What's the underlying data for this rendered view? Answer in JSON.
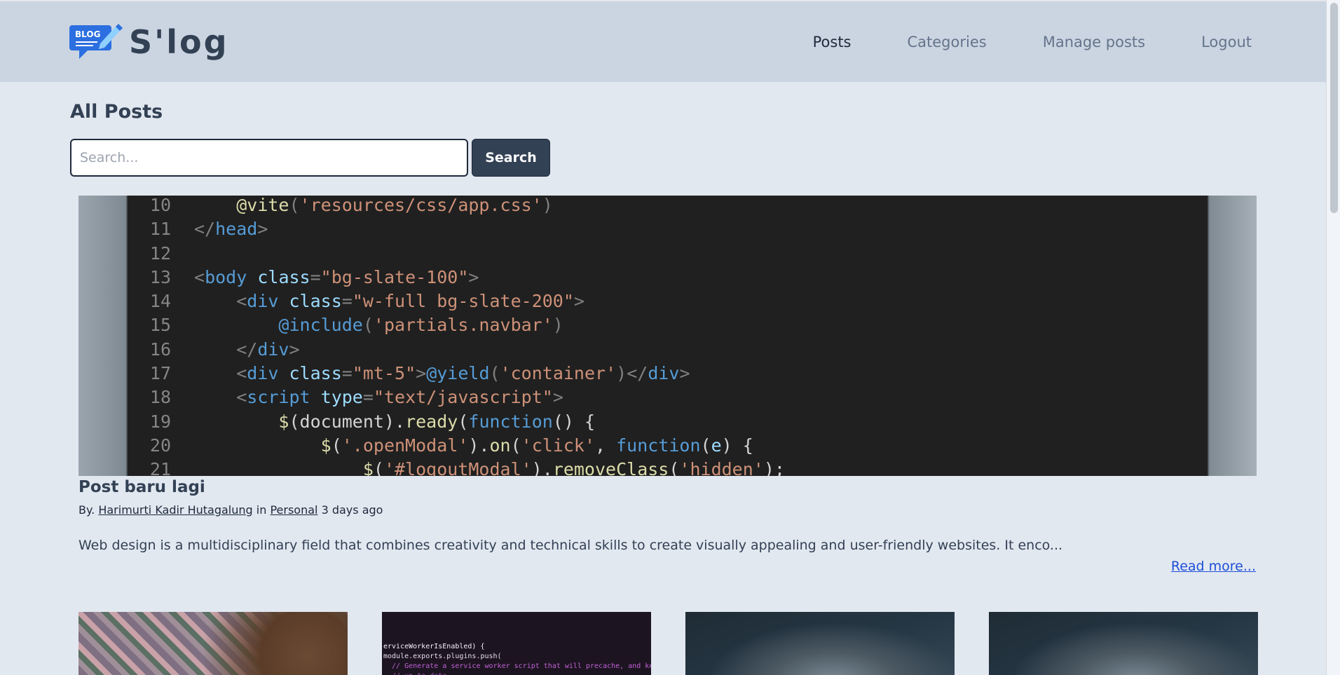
{
  "navbar": {
    "logo_text": "BLOG",
    "brand": "S'log",
    "links": [
      "Posts",
      "Categories",
      "Manage posts",
      "Logout"
    ]
  },
  "page": {
    "title": "All Posts"
  },
  "search": {
    "placeholder": "Search...",
    "button": "Search"
  },
  "featured": {
    "code_lines": [
      {
        "n": "10",
        "tokens": [
          [
            "txt",
            "    "
          ],
          [
            "fn",
            "@vite"
          ],
          [
            "punc",
            "("
          ],
          [
            "str",
            "'resources/css/app.css'"
          ],
          [
            "punc",
            ")"
          ]
        ]
      },
      {
        "n": "11",
        "tokens": [
          [
            "punc",
            "</"
          ],
          [
            "tag",
            "head"
          ],
          [
            "punc",
            ">"
          ]
        ]
      },
      {
        "n": "12",
        "tokens": []
      },
      {
        "n": "13",
        "tokens": [
          [
            "punc",
            "<"
          ],
          [
            "tag",
            "body"
          ],
          [
            "txt",
            " "
          ],
          [
            "attr",
            "class"
          ],
          [
            "punc",
            "="
          ],
          [
            "str",
            "\"bg-slate-100\""
          ],
          [
            "punc",
            ">"
          ]
        ]
      },
      {
        "n": "14",
        "tokens": [
          [
            "txt",
            "    "
          ],
          [
            "punc",
            "<"
          ],
          [
            "tag",
            "div"
          ],
          [
            "txt",
            " "
          ],
          [
            "attr",
            "class"
          ],
          [
            "punc",
            "="
          ],
          [
            "str",
            "\"w-full bg-slate-200\""
          ],
          [
            "punc",
            ">"
          ]
        ]
      },
      {
        "n": "15",
        "tokens": [
          [
            "txt",
            "        "
          ],
          [
            "dir",
            "@include"
          ],
          [
            "punc",
            "("
          ],
          [
            "str",
            "'partials.navbar'"
          ],
          [
            "punc",
            ")"
          ]
        ]
      },
      {
        "n": "16",
        "tokens": [
          [
            "txt",
            "    "
          ],
          [
            "punc",
            "</"
          ],
          [
            "tag",
            "div"
          ],
          [
            "punc",
            ">"
          ]
        ]
      },
      {
        "n": "17",
        "tokens": [
          [
            "txt",
            "    "
          ],
          [
            "punc",
            "<"
          ],
          [
            "tag",
            "div"
          ],
          [
            "txt",
            " "
          ],
          [
            "attr",
            "class"
          ],
          [
            "punc",
            "="
          ],
          [
            "str",
            "\"mt-5\""
          ],
          [
            "punc",
            ">"
          ],
          [
            "dir",
            "@yield"
          ],
          [
            "punc",
            "("
          ],
          [
            "str",
            "'container'"
          ],
          [
            "punc",
            ")"
          ],
          [
            "punc",
            "</"
          ],
          [
            "tag",
            "div"
          ],
          [
            "punc",
            ">"
          ]
        ]
      },
      {
        "n": "18",
        "tokens": [
          [
            "txt",
            "    "
          ],
          [
            "punc",
            "<"
          ],
          [
            "tag",
            "script"
          ],
          [
            "txt",
            " "
          ],
          [
            "attr",
            "type"
          ],
          [
            "punc",
            "="
          ],
          [
            "str",
            "\"text/javascript\""
          ],
          [
            "punc",
            ">"
          ]
        ]
      },
      {
        "n": "19",
        "tokens": [
          [
            "txt",
            "        "
          ],
          [
            "fn",
            "$"
          ],
          [
            "txt",
            "(document)."
          ],
          [
            "fn",
            "ready"
          ],
          [
            "txt",
            "("
          ],
          [
            "kw",
            "function"
          ],
          [
            "txt",
            "() {"
          ]
        ]
      },
      {
        "n": "20",
        "tokens": [
          [
            "txt",
            "            "
          ],
          [
            "fn",
            "$"
          ],
          [
            "txt",
            "("
          ],
          [
            "str",
            "'.openModal'"
          ],
          [
            "txt",
            ")."
          ],
          [
            "fn",
            "on"
          ],
          [
            "txt",
            "("
          ],
          [
            "str",
            "'click'"
          ],
          [
            "txt",
            ", "
          ],
          [
            "kw",
            "function"
          ],
          [
            "txt",
            "("
          ],
          [
            "attr",
            "e"
          ],
          [
            "txt",
            ") {"
          ]
        ]
      },
      {
        "n": "21",
        "tokens": [
          [
            "txt",
            "                "
          ],
          [
            "fn",
            "$"
          ],
          [
            "txt",
            "("
          ],
          [
            "str",
            "'#logoutModal'"
          ],
          [
            "txt",
            ")."
          ],
          [
            "fn",
            "removeClass"
          ],
          [
            "txt",
            "("
          ],
          [
            "str",
            "'hidden'"
          ],
          [
            "txt",
            ");"
          ]
        ]
      }
    ]
  },
  "post": {
    "title": "Post baru lagi",
    "by_label": "By.",
    "author": "Harimurti Kadir Hutagalung",
    "in_label": "in",
    "category": "Personal",
    "time": "3 days ago",
    "excerpt": "Web design is a multidisciplinary field that combines creativity and technical skills to create visually appealing and user-friendly websites. It enco...",
    "read_more": "Read more..."
  },
  "cards": {
    "thumb2_lines": [
      {
        "text": "erviceWorkerIsEnabled) {",
        "color": "#f5f0ff"
      },
      {
        "text": "module.exports.plugins.push(",
        "color": "#e6dcf0"
      },
      {
        "text": "  // Generate a service worker script that will precache, and keep",
        "color": "#c061d6"
      },
      {
        "text": "  // up to date",
        "color": "#a34fb8"
      }
    ]
  }
}
